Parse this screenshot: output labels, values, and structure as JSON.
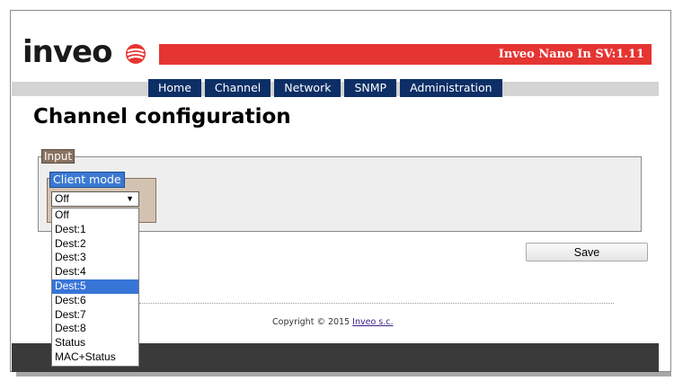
{
  "header": {
    "logo_text": "inveo",
    "device_title": "Inveo Nano In SV:1.11"
  },
  "nav": {
    "items": [
      {
        "label": "Home"
      },
      {
        "label": "Channel"
      },
      {
        "label": "Network"
      },
      {
        "label": "SNMP"
      },
      {
        "label": "Administration"
      }
    ]
  },
  "page": {
    "title": "Channel configuration"
  },
  "input_group": {
    "legend": "Input",
    "client_mode": {
      "legend": "Client mode",
      "selected_value": "Off",
      "options": [
        "Off",
        "Dest:1",
        "Dest:2",
        "Dest:3",
        "Dest:4",
        "Dest:5",
        "Dest:6",
        "Dest:7",
        "Dest:8",
        "Status",
        "MAC+Status"
      ],
      "highlighted_option": "Dest:5"
    }
  },
  "actions": {
    "save_label": "Save"
  },
  "footer": {
    "copyright_text": "Copyright © 2015",
    "company_link": "Inveo s.c."
  },
  "colors": {
    "brand_red": "#e53532",
    "nav_blue": "#0d2f66",
    "input_legend": "#8b7261",
    "client_legend": "#3b79d1",
    "highlight": "#3875d7"
  },
  "icons": {
    "logo_mark": "inveo-logo-icon",
    "select_arrow": "triangle-down-icon"
  }
}
